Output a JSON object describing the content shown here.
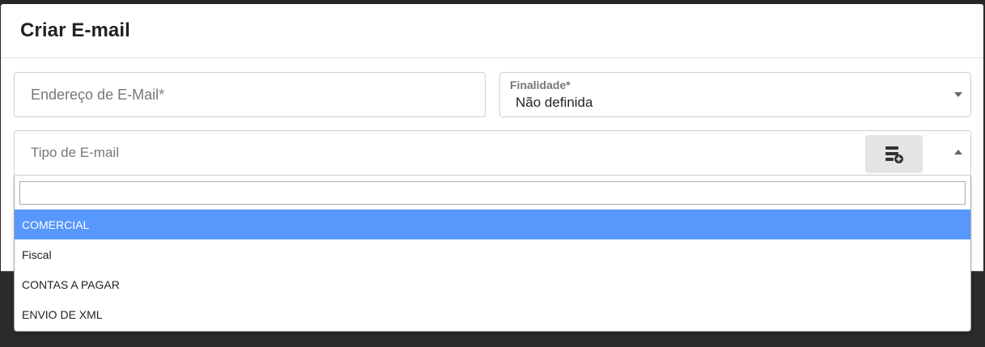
{
  "modal": {
    "title": "Criar E-mail"
  },
  "email_field": {
    "placeholder": "Endereço de E-Mail*",
    "value": ""
  },
  "finalidade": {
    "label": "Finalidade*",
    "value": "Não definida"
  },
  "tipo_email": {
    "placeholder": "Tipo de E-mail",
    "add_button_icon": "add-list-icon",
    "search_value": "",
    "options": [
      "COMERCIAL",
      "Fiscal",
      "CONTAS A PAGAR",
      "ENVIO DE XML"
    ],
    "highlighted_option": "COMERCIAL"
  },
  "colors": {
    "highlight": "#5897fb",
    "button_bg": "#e4e4e4"
  }
}
